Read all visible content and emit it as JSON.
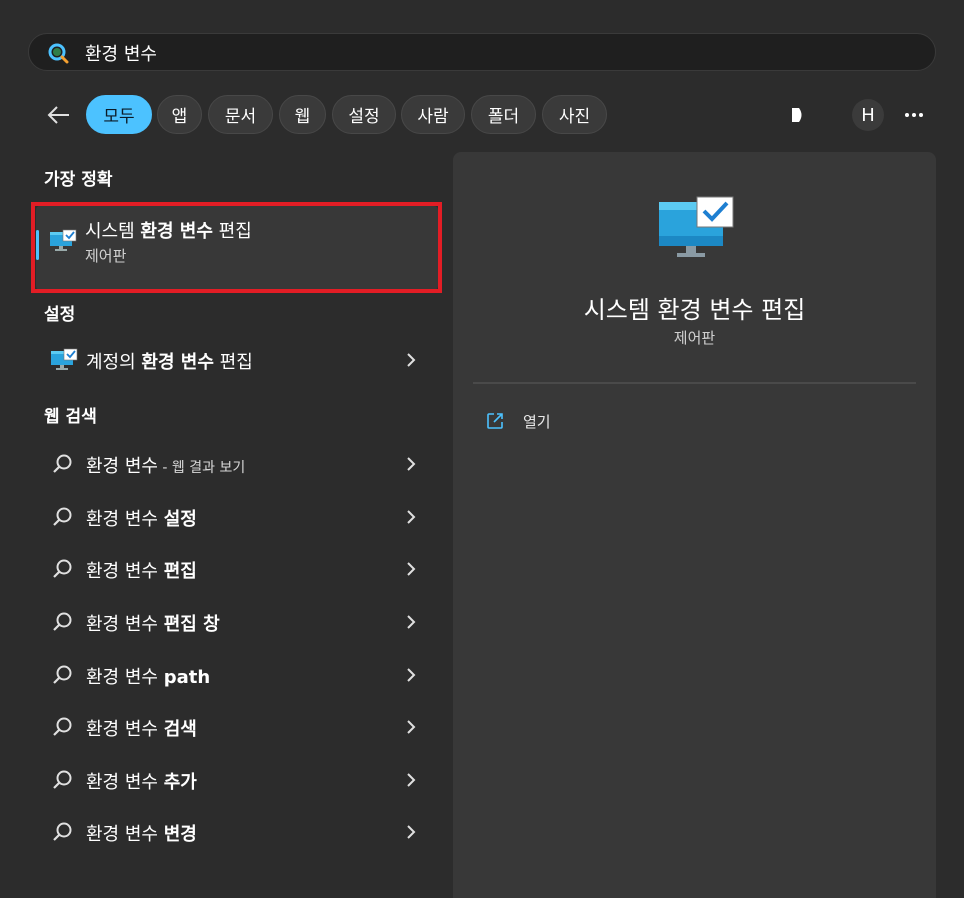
{
  "search": {
    "value": "환경 변수",
    "icon": "search-icon"
  },
  "filters": {
    "chips": [
      "모두",
      "앱",
      "문서",
      "웹",
      "설정",
      "사람",
      "폴더",
      "사진"
    ],
    "active": "모두",
    "avatar_letter": "H"
  },
  "best_match": {
    "section": "가장 정확",
    "title_pre": "시스템 ",
    "title_bold": "환경 변수",
    "title_post": " 편집",
    "subtitle": "제어판"
  },
  "settings": {
    "section": "설정",
    "item_pre": "계정의 ",
    "item_bold": "환경 변수",
    "item_post": " 편집"
  },
  "web": {
    "section": "웹 검색",
    "items": [
      {
        "text": "환경 변수",
        "bold": "",
        "small": " - 웹 결과 보기"
      },
      {
        "text": "환경 변수 ",
        "bold": "설정",
        "small": ""
      },
      {
        "text": "환경 변수 ",
        "bold": "편집",
        "small": ""
      },
      {
        "text": "환경 변수 ",
        "bold": "편집 창",
        "small": ""
      },
      {
        "text": "환경 변수 ",
        "bold": "path",
        "small": ""
      },
      {
        "text": "환경 변수 ",
        "bold": "검색",
        "small": ""
      },
      {
        "text": "환경 변수 ",
        "bold": "추가",
        "small": ""
      },
      {
        "text": "환경 변수 ",
        "bold": "변경",
        "small": ""
      }
    ]
  },
  "preview": {
    "title": "시스템 환경 변수 편집",
    "subtitle": "제어판",
    "open_label": "열기"
  },
  "colors": {
    "accent": "#4cc2ff",
    "highlight": "#e21d25",
    "panel": "#383838",
    "background": "#2c2c2c"
  }
}
